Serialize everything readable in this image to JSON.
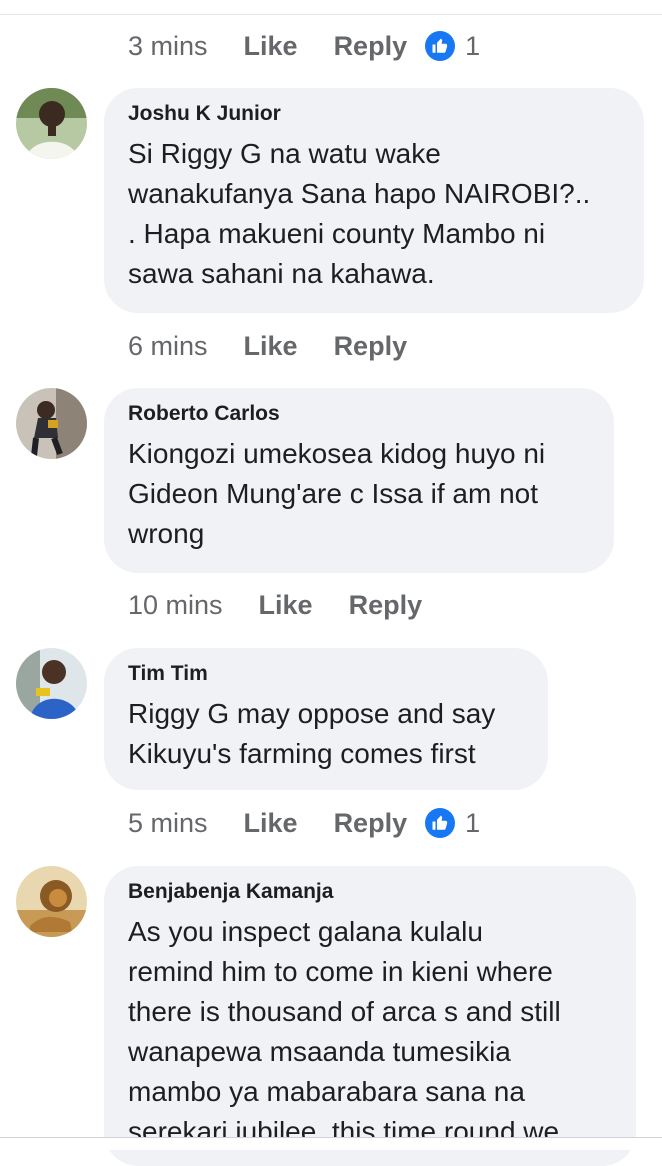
{
  "comments": [
    {
      "time": "3 mins",
      "like_label": "Like",
      "reply_label": "Reply",
      "reaction_count": "1"
    },
    {
      "author": "Joshu K Junior",
      "lines": [
        "Si Riggy G na watu wake",
        "wanakufanya Sana hapo NAIROBI?..",
        ". Hapa makueni county Mambo ni",
        "sawa sahani na kahawa."
      ],
      "time": "6 mins",
      "like_label": "Like",
      "reply_label": "Reply"
    },
    {
      "author": "Roberto Carlos",
      "lines": [
        "Kiongozi umekosea kidog huyo ni",
        "Gideon Mung'are c Issa if am not",
        "wrong"
      ],
      "time": "10 mins",
      "like_label": "Like",
      "reply_label": "Reply"
    },
    {
      "author": "Tim Tim",
      "lines": [
        "Riggy G may oppose and say",
        "Kikuyu's farming comes first"
      ],
      "time": "5 mins",
      "like_label": "Like",
      "reply_label": "Reply",
      "reaction_count": "1"
    },
    {
      "author": "Benjabenja Kamanja",
      "lines": [
        "As  you inspect galana kulalu",
        "remind him to come in kieni where",
        "there is thousand of arca s and still",
        "wanapewa msaanda tumesikia",
        "mambo ya mabarabara sana na",
        "serekari jubilee, this time round we"
      ]
    }
  ],
  "colors": {
    "bubble": "#f0f2f5",
    "meta_text": "#65676b",
    "like_blue": "#1877f2"
  },
  "icons": [
    "thumbs-up-icon"
  ]
}
